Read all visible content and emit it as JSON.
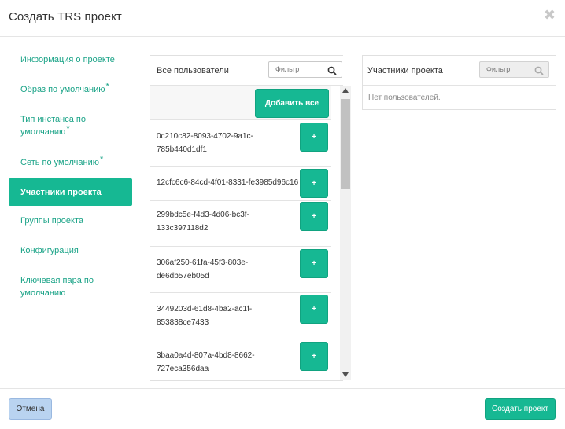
{
  "dialog": {
    "title": "Создать TRS проект",
    "close_glyph": "✖"
  },
  "nav": {
    "items": [
      {
        "label": "Информация о проекте",
        "required": false,
        "active": false
      },
      {
        "label": "Образ по умолчанию",
        "required": true,
        "active": false
      },
      {
        "label_line1": "Тип инстанса по",
        "label_line2": "умолчанию",
        "required": true,
        "active": false
      },
      {
        "label": "Сеть по умолчанию",
        "required": true,
        "active": false
      },
      {
        "label": "Участники проекта",
        "required": false,
        "active": true
      },
      {
        "label": "Группы проекта",
        "required": false,
        "active": false
      },
      {
        "label": "Конфигурация",
        "required": false,
        "active": false
      },
      {
        "label_line1": "Ключевая пара по",
        "label_line2": "умолчанию",
        "required": false,
        "active": false
      }
    ],
    "required_mark": "*"
  },
  "all_users": {
    "title": "Все пользователи",
    "filter_placeholder": "Фильтр",
    "add_all_label": "Добавить все",
    "add_label": "+",
    "users": [
      {
        "line1": "0c210c82-8093-4702-9a1c-",
        "line2": "785b440d1df1"
      },
      {
        "line1": "12cfc6c6-84cd-4f01-8331-fe3985d96c16",
        "line2": ""
      },
      {
        "line1": "299bdc5e-f4d3-4d06-bc3f-",
        "line2": "133c397118d2"
      },
      {
        "line1": "306af250-61fa-45f3-803e-",
        "line2": "de6db57eb05d"
      },
      {
        "line1": "3449203d-61d8-4ba2-ac1f-",
        "line2": "853838ce7433"
      },
      {
        "line1": "3baa0a4d-807a-4bd8-8662-",
        "line2": "727eca356daa"
      }
    ]
  },
  "project_members": {
    "title": "Участники проекта",
    "filter_placeholder": "Фильтр",
    "empty_text": "Нет пользователей."
  },
  "footer": {
    "cancel_label": "Отмена",
    "create_label": "Создать проект"
  },
  "colors": {
    "accent": "#16b893",
    "link": "#1aa387",
    "cancel_bg": "#b9d3f0"
  }
}
